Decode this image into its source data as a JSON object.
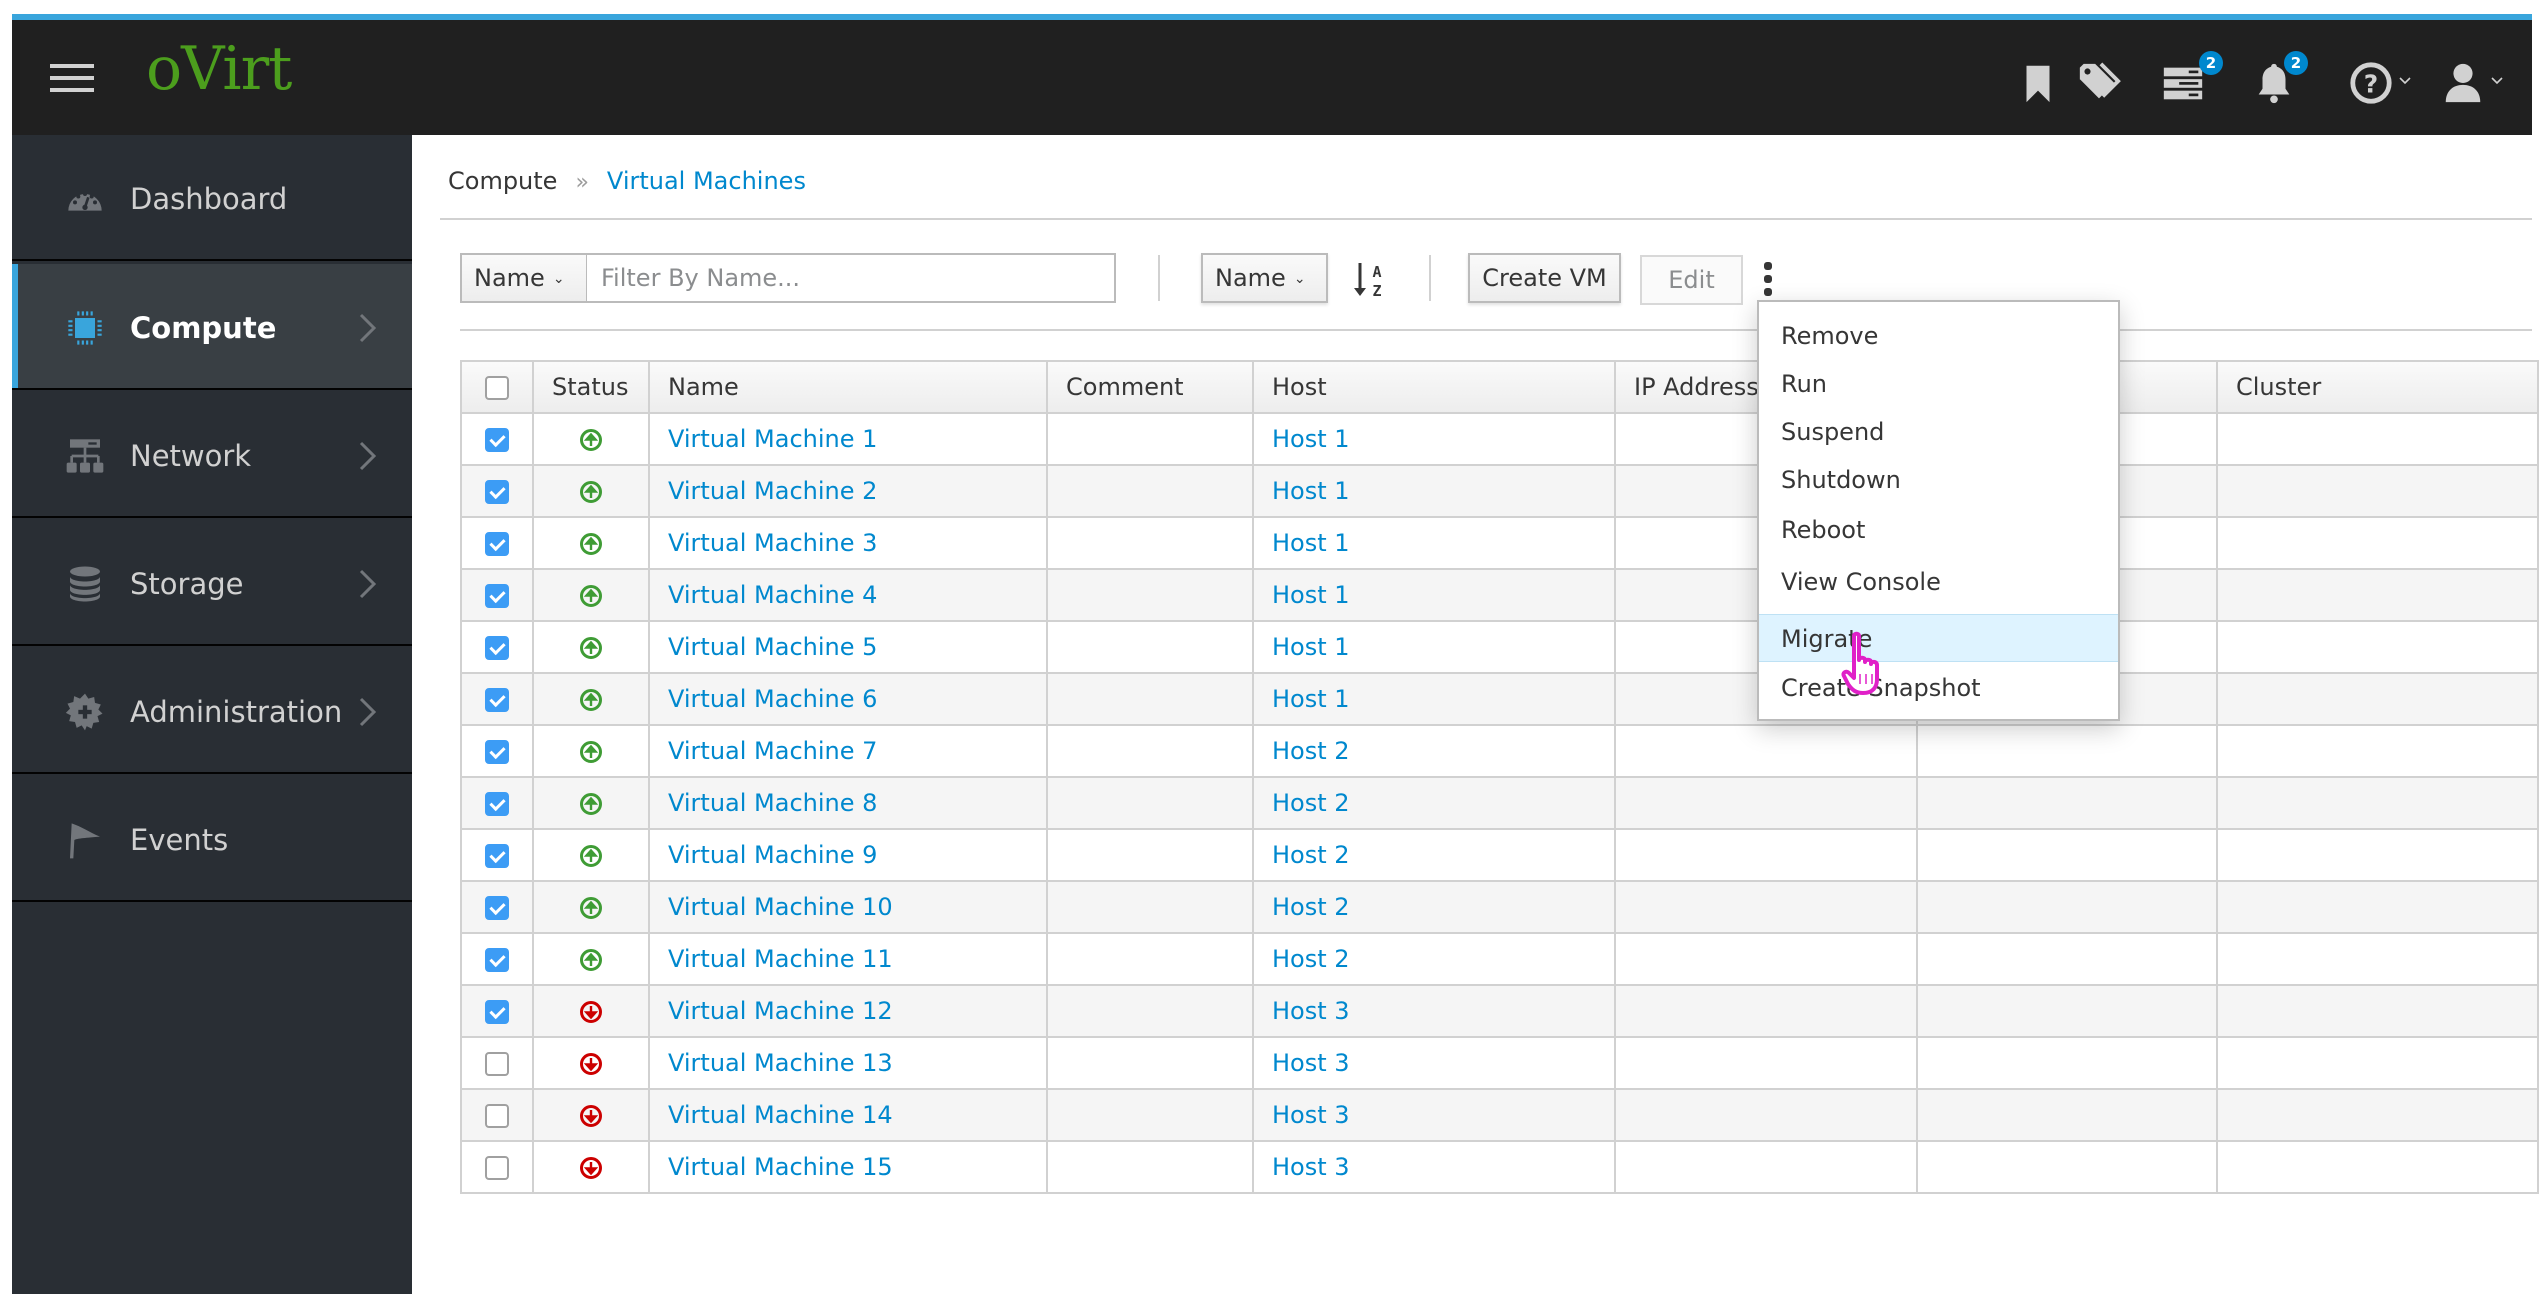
{
  "app": {
    "logo": "oVirt",
    "accent": "#39a5dc",
    "logo_color": "#4c9e1d"
  },
  "header": {
    "icons": [
      {
        "name": "bookmark-icon"
      },
      {
        "name": "tag-icon"
      },
      {
        "name": "tasks-icon",
        "badge": "2"
      },
      {
        "name": "bell-icon",
        "badge": "2"
      },
      {
        "name": "help-icon",
        "dropdown": true
      },
      {
        "name": "user-icon",
        "dropdown": true
      }
    ]
  },
  "sidebar": {
    "items": [
      {
        "label": "Dashboard",
        "icon": "dashboard-icon",
        "chevron": false,
        "active": false
      },
      {
        "label": "Compute",
        "icon": "cpu-icon",
        "chevron": true,
        "active": true
      },
      {
        "label": "Network",
        "icon": "network-icon",
        "chevron": true,
        "active": false
      },
      {
        "label": "Storage",
        "icon": "database-icon",
        "chevron": true,
        "active": false
      },
      {
        "label": "Administration",
        "icon": "gear-icon",
        "chevron": true,
        "active": false
      },
      {
        "label": "Events",
        "icon": "flag-icon",
        "chevron": false,
        "active": false
      }
    ]
  },
  "breadcrumb": {
    "parent": "Compute",
    "separator": "»",
    "current": "Virtual Machines"
  },
  "toolbar": {
    "filter_field": "Name",
    "filter_placeholder": "Filter By Name...",
    "filter_value": "",
    "sort_field": "Name",
    "sort_icon": "sort-alpha-asc-icon",
    "create_label": "Create VM",
    "edit_label": "Edit",
    "kebab_icon": "kebab-icon"
  },
  "table": {
    "columns": [
      "Status",
      "Name",
      "Comment",
      "Host",
      "IP Addresses",
      "",
      "Cluster"
    ],
    "rows": [
      {
        "checked": true,
        "status": "up",
        "name": "Virtual Machine 1",
        "comment": "",
        "host": "Host 1",
        "ip": "",
        "hidden": "",
        "cluster": ""
      },
      {
        "checked": true,
        "status": "up",
        "name": "Virtual Machine 2",
        "comment": "",
        "host": "Host 1",
        "ip": "",
        "hidden": "",
        "cluster": ""
      },
      {
        "checked": true,
        "status": "up",
        "name": "Virtual Machine 3",
        "comment": "",
        "host": "Host 1",
        "ip": "",
        "hidden": "",
        "cluster": ""
      },
      {
        "checked": true,
        "status": "up",
        "name": "Virtual Machine 4",
        "comment": "",
        "host": "Host 1",
        "ip": "",
        "hidden": "",
        "cluster": ""
      },
      {
        "checked": true,
        "status": "up",
        "name": "Virtual Machine 5",
        "comment": "",
        "host": "Host 1",
        "ip": "",
        "hidden": "",
        "cluster": ""
      },
      {
        "checked": true,
        "status": "up",
        "name": "Virtual Machine 6",
        "comment": "",
        "host": "Host 1",
        "ip": "",
        "hidden": "",
        "cluster": ""
      },
      {
        "checked": true,
        "status": "up",
        "name": "Virtual Machine 7",
        "comment": "",
        "host": "Host 2",
        "ip": "",
        "hidden": "",
        "cluster": ""
      },
      {
        "checked": true,
        "status": "up",
        "name": "Virtual Machine 8",
        "comment": "",
        "host": "Host 2",
        "ip": "",
        "hidden": "",
        "cluster": ""
      },
      {
        "checked": true,
        "status": "up",
        "name": "Virtual Machine 9",
        "comment": "",
        "host": "Host 2",
        "ip": "",
        "hidden": "",
        "cluster": ""
      },
      {
        "checked": true,
        "status": "up",
        "name": "Virtual Machine 10",
        "comment": "",
        "host": "Host 2",
        "ip": "",
        "hidden": "",
        "cluster": ""
      },
      {
        "checked": true,
        "status": "up",
        "name": "Virtual Machine 11",
        "comment": "",
        "host": "Host 2",
        "ip": "",
        "hidden": "",
        "cluster": ""
      },
      {
        "checked": true,
        "status": "down",
        "name": "Virtual Machine 12",
        "comment": "",
        "host": "Host 3",
        "ip": "",
        "hidden": "",
        "cluster": ""
      },
      {
        "checked": false,
        "status": "down",
        "name": "Virtual Machine 13",
        "comment": "",
        "host": "Host 3",
        "ip": "",
        "hidden": "",
        "cluster": ""
      },
      {
        "checked": false,
        "status": "down",
        "name": "Virtual Machine 14",
        "comment": "",
        "host": "Host 3",
        "ip": "",
        "hidden": "",
        "cluster": ""
      },
      {
        "checked": false,
        "status": "down",
        "name": "Virtual Machine 15",
        "comment": "",
        "host": "Host 3",
        "ip": "",
        "hidden": "",
        "cluster": ""
      }
    ],
    "status_colors": {
      "up": "#3f9c35",
      "down": "#cc0000"
    },
    "select_all_checked": false
  },
  "menu": {
    "items": [
      "Remove",
      "Run",
      "Suspend",
      "Shutdown",
      "Reboot",
      "View Console",
      "Migrate",
      "Create Snapshot"
    ],
    "hovered": "Migrate",
    "cursor": "pointer-hand-cursor",
    "cursor_color": "#e020c8"
  }
}
